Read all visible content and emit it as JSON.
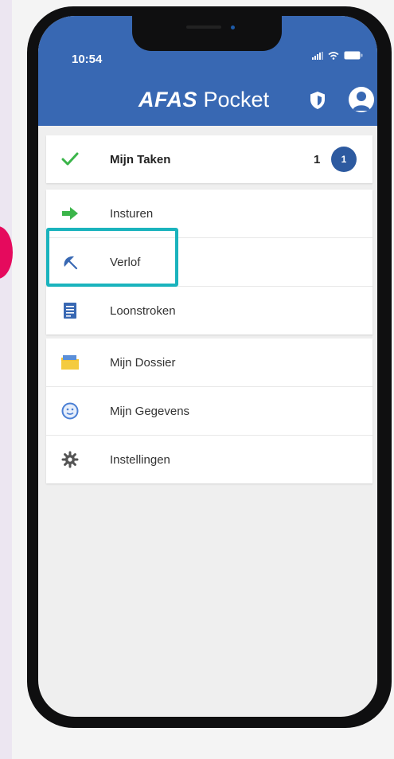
{
  "status_bar": {
    "time": "10:54"
  },
  "header": {
    "brand_bold": "AFAS",
    "brand_light": "Pocket"
  },
  "tasks": {
    "label": "Mijn Taken",
    "count": "1",
    "badge": "1"
  },
  "menu_group_1": [
    {
      "label": "Insturen",
      "icon": "arrow-right-icon"
    },
    {
      "label": "Verlof",
      "icon": "umbrella-icon"
    },
    {
      "label": "Loonstroken",
      "icon": "document-icon"
    }
  ],
  "menu_group_2": [
    {
      "label": "Mijn Dossier",
      "icon": "folder-icon"
    },
    {
      "label": "Mijn Gegevens",
      "icon": "smiley-icon"
    },
    {
      "label": "Instellingen",
      "icon": "gear-icon"
    }
  ],
  "colors": {
    "header": "#3868b3",
    "badge": "#2d5aa0",
    "highlight": "#1ab3bd",
    "check": "#3bb54a",
    "marker": "#e50a5d"
  }
}
